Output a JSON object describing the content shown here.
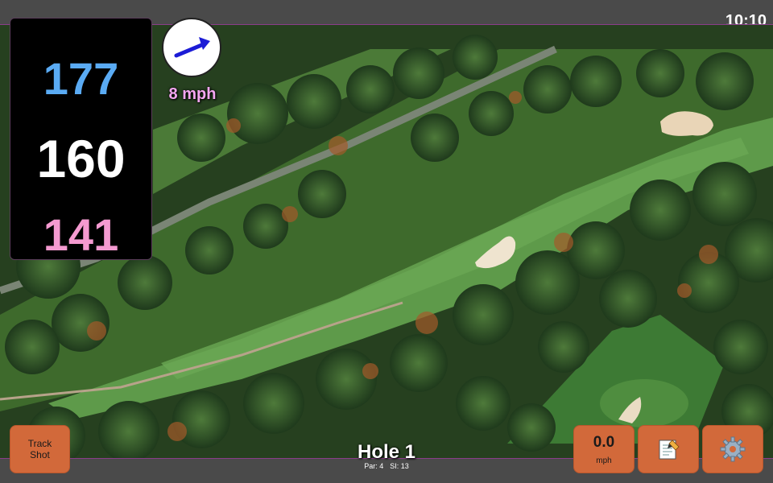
{
  "status_bar": {
    "time": "10:10"
  },
  "yardages": {
    "back": "177",
    "middle": "160",
    "front": "141"
  },
  "wind": {
    "speed": "8 mph",
    "arrow_color": "#1c1cd6"
  },
  "hole": {
    "title": "Hole 1",
    "par": "Par: 4",
    "stroke_index": "SI: 13"
  },
  "buttons": {
    "track_shot_line1": "Track",
    "track_shot_line2": "Shot",
    "speed_value": "0.0",
    "speed_unit": "mph"
  },
  "icons": {
    "notes": "notepad-icon",
    "settings": "gear-icon",
    "wind": "wind-arrow-icon"
  },
  "colors": {
    "button": "#d2693a",
    "back_yard": "#5aabf4",
    "middle_yard": "#ffffff",
    "front_yard": "#f49ad0"
  }
}
